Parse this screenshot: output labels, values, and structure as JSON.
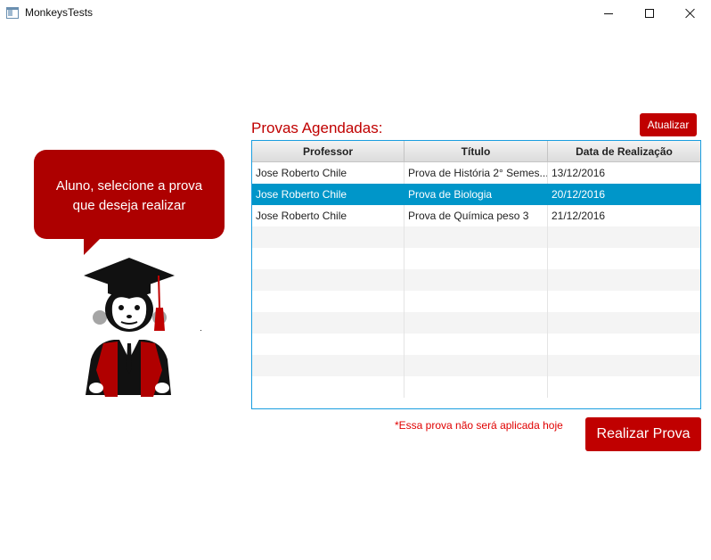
{
  "window": {
    "title": "MonkeysTests",
    "icon": "app-window-icon"
  },
  "bubble": {
    "line1": "Aluno, selecione a prova",
    "line2": "que deseja realizar",
    "color": "#ad0000"
  },
  "mascot": {
    "icon": "graduate-monkey-icon"
  },
  "section": {
    "title": "Provas Agendadas:"
  },
  "toolbar": {
    "refresh_label": "Atualizar"
  },
  "table": {
    "columns": [
      "Professor",
      "Título",
      "Data de Realização"
    ],
    "rows": [
      {
        "professor": "Jose Roberto Chile",
        "titulo": "Prova de História 2° Semes...",
        "data": "13/12/2016"
      },
      {
        "professor": "Jose Roberto Chile",
        "titulo": "Prova de Biologia",
        "data": "20/12/2016"
      },
      {
        "professor": "Jose Roberto Chile",
        "titulo": "Prova de Química peso 3",
        "data": "21/12/2016"
      }
    ],
    "selected_index": 1,
    "selected_color": "#0096c9"
  },
  "footer": {
    "warning": "*Essa prova não será aplicada hoje",
    "submit_label": "Realizar Prova"
  },
  "colors": {
    "accent": "#c00000",
    "table_border": "#1a9ee0"
  }
}
